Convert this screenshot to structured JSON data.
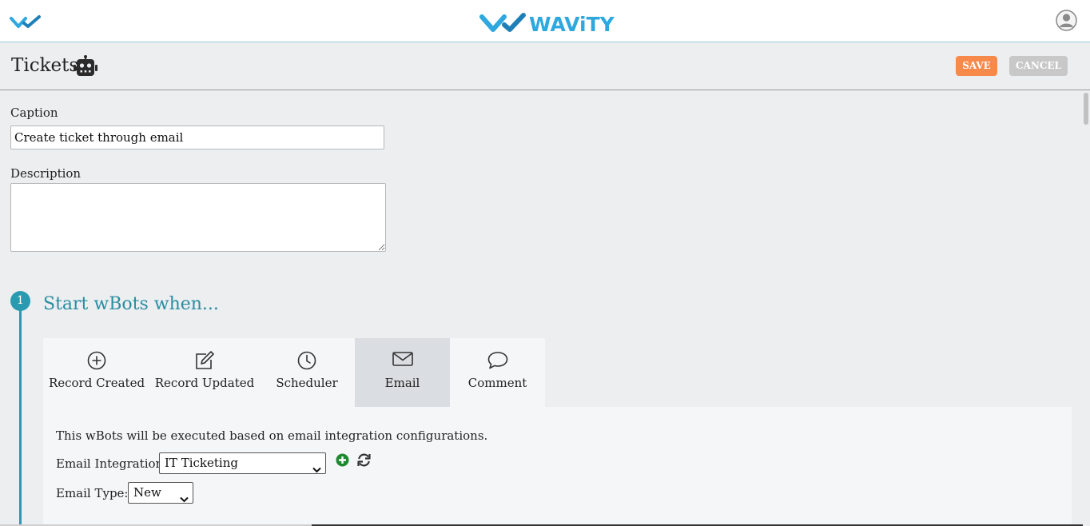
{
  "header": {
    "brand_name": "WAViTY",
    "colors": {
      "brand": "#2ea8de",
      "brand_dark": "#1e7fb8"
    }
  },
  "titlebar": {
    "title": "Tickets",
    "save_label": "SAVE",
    "cancel_label": "CANCEL",
    "colors": {
      "save": "#f7894a",
      "cancel": "#c8c8c8"
    }
  },
  "form": {
    "caption_label": "Caption",
    "caption_value": "Create ticket through email",
    "description_label": "Description",
    "description_value": ""
  },
  "step": {
    "number": "1",
    "title": "Start wBots when...",
    "color": "#2a9ab0",
    "tabs": [
      {
        "label": "Record Created",
        "icon": "plus-circle-icon"
      },
      {
        "label": "Record Updated",
        "icon": "edit-icon"
      },
      {
        "label": "Scheduler",
        "icon": "clock-icon"
      },
      {
        "label": "Email",
        "icon": "envelope-icon",
        "active": true
      },
      {
        "label": "Comment",
        "icon": "comment-icon"
      }
    ]
  },
  "email_panel": {
    "info_text": "This wBots will be executed based on email integration configurations.",
    "integration_label": "Email Integration:",
    "integration_value": "IT Ticketing",
    "type_label": "Email Type:",
    "type_value": "New"
  }
}
